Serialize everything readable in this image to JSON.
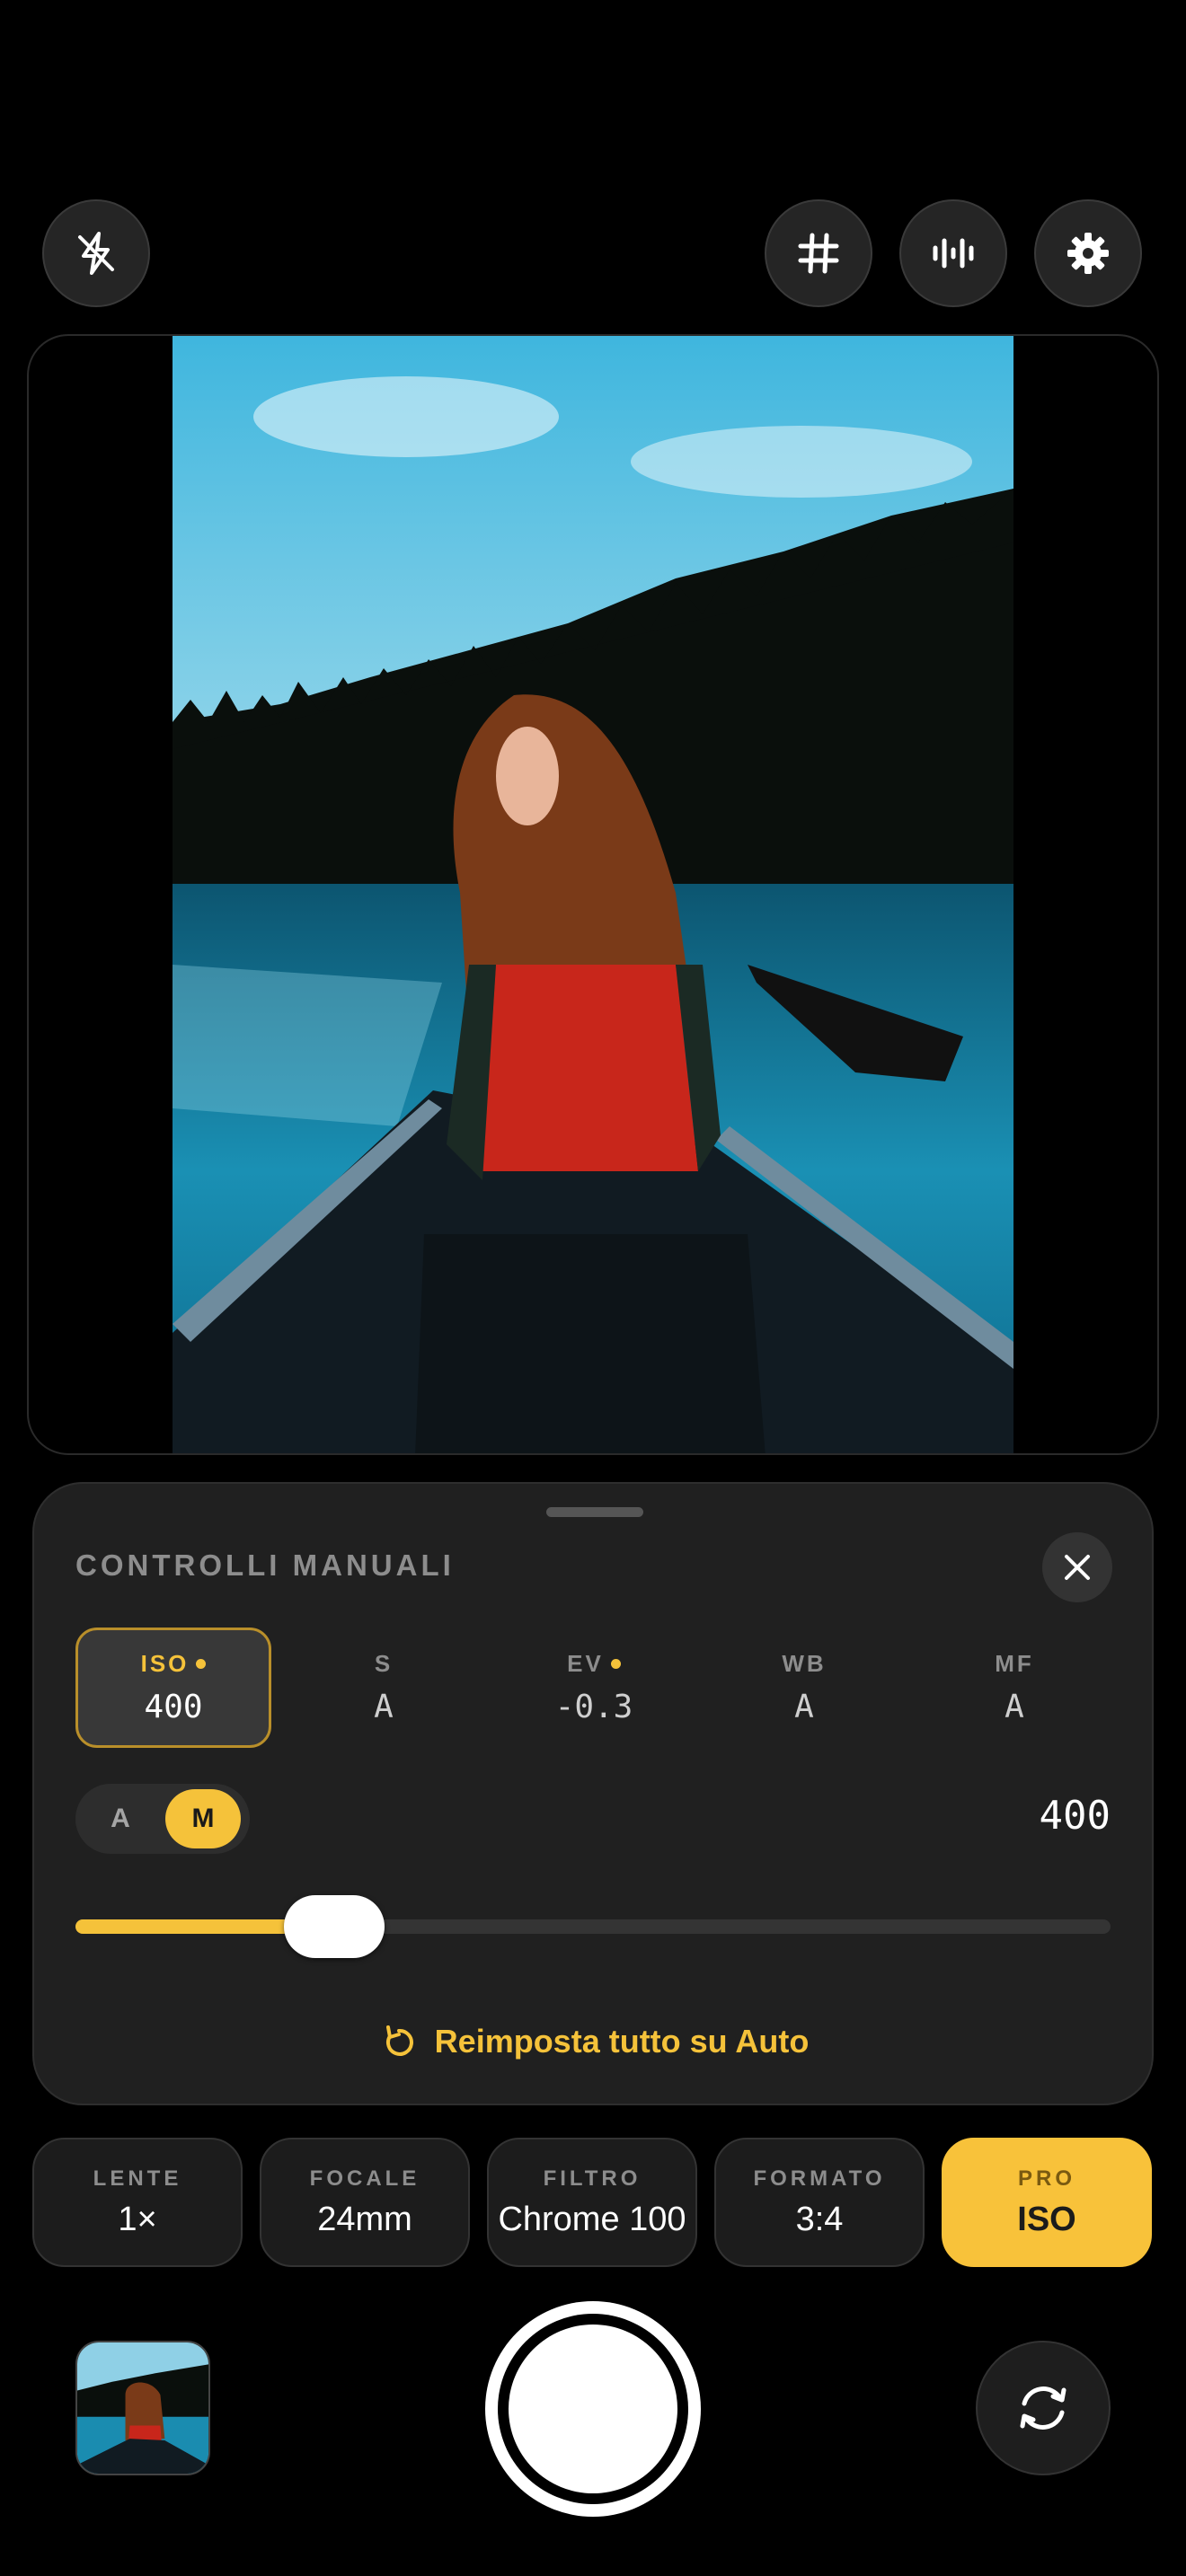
{
  "top_bar": {
    "icons": [
      "flash-off-icon",
      "grid-icon",
      "level-meter-icon",
      "settings-gear-icon"
    ]
  },
  "viewfinder": {
    "description_icon": "camera-preview"
  },
  "manual_panel": {
    "title": "CONTROLLI MANUALI",
    "params": [
      {
        "label": "ISO",
        "value": "400",
        "modified": true,
        "active": true
      },
      {
        "label": "S",
        "value": "A",
        "modified": false,
        "active": false
      },
      {
        "label": "EV",
        "value": "-0.3",
        "modified": true,
        "active": false
      },
      {
        "label": "WB",
        "value": "A",
        "modified": false,
        "active": false
      },
      {
        "label": "MF",
        "value": "A",
        "modified": false,
        "active": false
      }
    ],
    "mode_toggle": {
      "auto": "A",
      "manual": "M",
      "selected": "M"
    },
    "current_value": "400",
    "slider_level": 0.25,
    "reset_label": "Reimposta tutto su Auto"
  },
  "settings_pills": [
    {
      "label": "LENTE",
      "value": "1×"
    },
    {
      "label": "FOCALE",
      "value": "24mm"
    },
    {
      "label": "FILTRO",
      "value": "Chrome 100"
    },
    {
      "label": "FORMATO",
      "value": "3:4"
    },
    {
      "label": "PRO",
      "value": "ISO",
      "active": true
    }
  ],
  "colors": {
    "accent": "#F5C23A",
    "background": "#000000",
    "panel": "#202020"
  }
}
